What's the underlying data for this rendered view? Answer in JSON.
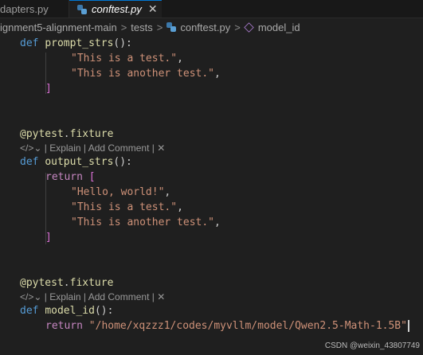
{
  "tabs": [
    {
      "label": "dapters.py",
      "active": false
    },
    {
      "label": "conftest.py",
      "active": true,
      "close": "✕"
    }
  ],
  "breadcrumb": {
    "parts": [
      "ignment5-alignment-main",
      "tests",
      "conftest.py",
      "model_id"
    ],
    "sep": ">"
  },
  "code": {
    "l1": {
      "kw": "def",
      "name": "prompt_strs",
      "tail": "():"
    },
    "l2": "\"This is a test.\"",
    "l3": "\"This is another test.\"",
    "l4": "]",
    "l5": {
      "at": "@",
      "mod": "pytest",
      "attr": "fixture"
    },
    "lens1": "| Explain | Add Comment |",
    "l6": {
      "kw": "def",
      "name": "output_strs",
      "tail": "():"
    },
    "l7": {
      "kw": "return",
      "br": "["
    },
    "l8": "\"Hello, world!\"",
    "l9": "\"This is a test.\"",
    "l10": "\"This is another test.\"",
    "l11": "]",
    "l12": {
      "at": "@",
      "mod": "pytest",
      "attr": "fixture"
    },
    "lens2": "| Explain | Add Comment |",
    "l13": {
      "kw": "def",
      "name": "model_id",
      "tail": "():"
    },
    "l14": {
      "kw": "return",
      "str": "\"/home/xqzzz1/codes/myvllm/model/Qwen2.5-Math-1.5B\""
    }
  },
  "watermark": "CSDN @weixin_43807749"
}
